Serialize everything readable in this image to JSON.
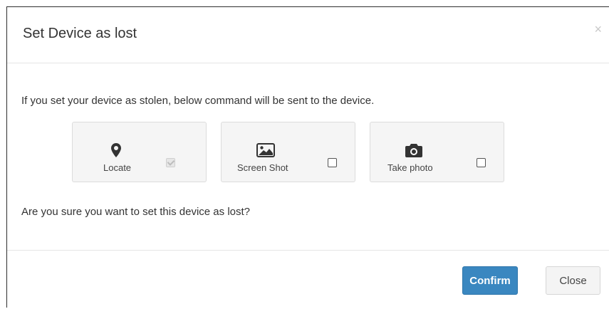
{
  "dialog": {
    "title": "Set Device as lost",
    "close_glyph": "×",
    "intro": "If you set your device as stolen, below command will be sent to the device.",
    "question": "Are you sure you want to set this device as lost?"
  },
  "commands": [
    {
      "label": "Locate",
      "icon": "map-pin-icon",
      "checked": true,
      "disabled": true
    },
    {
      "label": "Screen Shot",
      "icon": "image-icon",
      "checked": false,
      "disabled": false
    },
    {
      "label": "Take photo",
      "icon": "camera-icon",
      "checked": false,
      "disabled": false
    }
  ],
  "footer": {
    "confirm_label": "Confirm",
    "close_label": "Close"
  },
  "colors": {
    "primary": "#3a87c0",
    "icon": "#333333"
  }
}
